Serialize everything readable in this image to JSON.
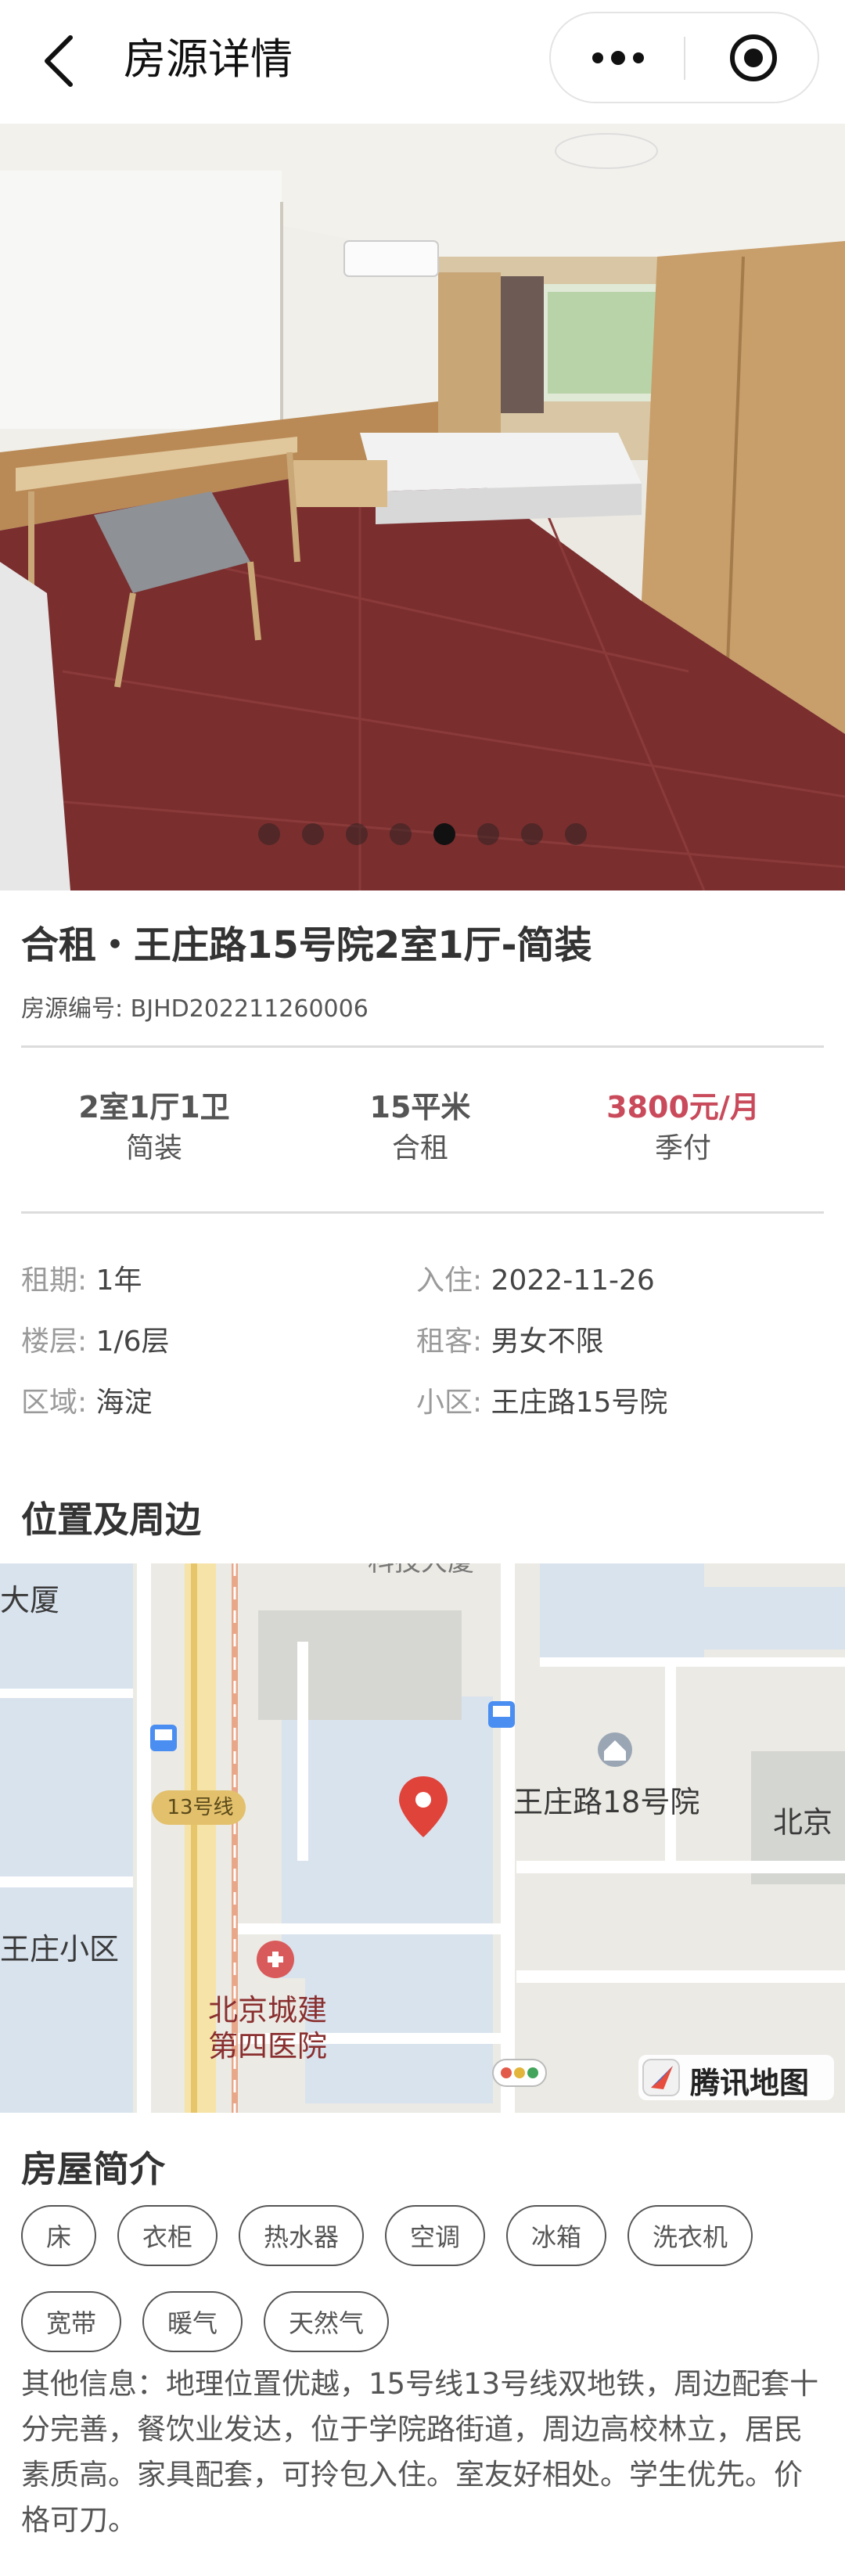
{
  "nav": {
    "title": "房源详情"
  },
  "gallery": {
    "count": 8,
    "active_index": 4
  },
  "listing": {
    "title": "合租・王庄路15号院2室1厅-简装",
    "code_label": "房源编号:",
    "code_value": "BJHD202211260006"
  },
  "stats": [
    {
      "value": "2室1厅1卫",
      "sub": "简装"
    },
    {
      "value": "15平米",
      "sub": "合租"
    },
    {
      "value": "3800元/月",
      "sub": "季付"
    }
  ],
  "details": [
    {
      "key": "租期:",
      "value": "1年"
    },
    {
      "key": "入住:",
      "value": "2022-11-26"
    },
    {
      "key": "楼层:",
      "value": "1/6层"
    },
    {
      "key": "租客:",
      "value": "男女不限"
    },
    {
      "key": "区域:",
      "value": "海淀"
    },
    {
      "key": "小区:",
      "value": "王庄路15号院"
    }
  ],
  "location": {
    "section_title": "位置及周边",
    "map_labels": {
      "top_left": "大厦",
      "top_center": "科技大厦",
      "metro_line": "13号线",
      "poi_main": "王庄路18号院",
      "right_edge": "北京",
      "left_community": "王庄小区",
      "hospital_line1": "北京城建",
      "hospital_line2": "第四医院",
      "brand": "腾讯地图"
    }
  },
  "intro": {
    "section_title": "房屋简介",
    "tags": [
      "床",
      "衣柜",
      "热水器",
      "空调",
      "冰箱",
      "洗衣机",
      "宽带",
      "暖气",
      "天然气"
    ],
    "description": "其他信息：地理位置优越，15号线13号线双地铁，周边配套十分完善，餐饮业发达，位于学院路街道，周边高校林立，居民素质高。家具配套，可拎包入住。室友好相处。学生优先。价格可刀。"
  },
  "colors": {
    "price": "#c94a5a",
    "map_pin": "#e0433a",
    "hospital": "#d95a5a",
    "metro_badge": "#e3c06b"
  }
}
